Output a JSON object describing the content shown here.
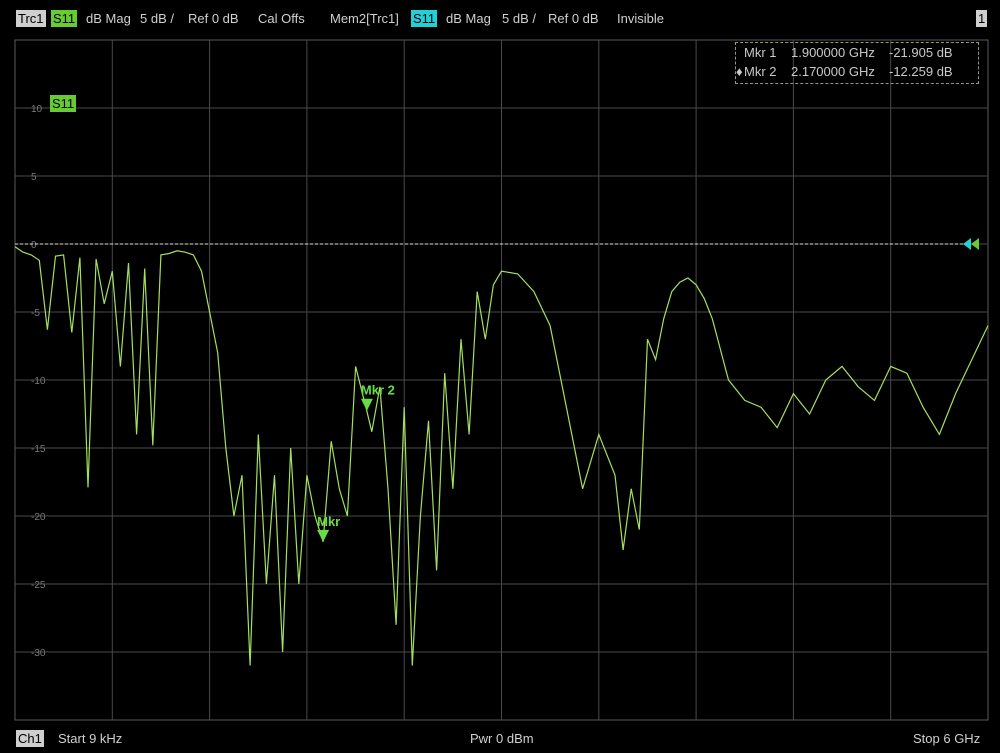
{
  "header": {
    "trace_label": "Trc1",
    "trace_param": "S11",
    "trace_format": "dB Mag",
    "trace_scale": "5 dB /",
    "trace_ref": "Ref 0 dB",
    "trace_cal": "Cal Offs",
    "mem_label": "Mem2[Trc1]",
    "mem_param": "S11",
    "mem_format": "dB Mag",
    "mem_scale": "5 dB /",
    "mem_ref": "Ref 0 dB",
    "mem_state": "Invisible",
    "window_number": "1"
  },
  "plot": {
    "trace_tag": "S11",
    "y_ticks": [
      "10",
      "5",
      "0",
      "-5",
      "-10",
      "-15",
      "-20",
      "-25",
      "-30"
    ],
    "colors": {
      "trace": "#a4e060",
      "marker": "#66dd44",
      "grid": "#4a4a4a",
      "reference_line": "#dddddd",
      "ref_arrow_cyan": "#22d0d8",
      "ref_arrow_green": "#66cc33"
    },
    "markers": [
      {
        "label": "Mkr",
        "freq_ghz": 1.9,
        "db": -21.905
      },
      {
        "label": "Mkr 2",
        "freq_ghz": 2.17,
        "db": -12.259
      }
    ]
  },
  "chart_data": {
    "type": "line",
    "title": "",
    "xlabel": "",
    "ylabel": "",
    "xlim": [
      9e-06,
      6
    ],
    "ylim": [
      -35,
      15
    ],
    "grid": true,
    "series": [
      {
        "name": "S11",
        "x": [
          0,
          0.05,
          0.1,
          0.15,
          0.2,
          0.25,
          0.3,
          0.35,
          0.4,
          0.45,
          0.5,
          0.55,
          0.6,
          0.65,
          0.7,
          0.75,
          0.8,
          0.85,
          0.9,
          0.95,
          1.0,
          1.05,
          1.1,
          1.15,
          1.2,
          1.25,
          1.3,
          1.35,
          1.4,
          1.45,
          1.5,
          1.55,
          1.6,
          1.65,
          1.7,
          1.75,
          1.8,
          1.85,
          1.9,
          1.95,
          2.0,
          2.05,
          2.1,
          2.17,
          2.2,
          2.25,
          2.3,
          2.35,
          2.4,
          2.45,
          2.5,
          2.55,
          2.6,
          2.65,
          2.7,
          2.75,
          2.8,
          2.85,
          2.9,
          2.95,
          3.0,
          3.1,
          3.2,
          3.3,
          3.4,
          3.5,
          3.6,
          3.7,
          3.75,
          3.8,
          3.85,
          3.9,
          3.95,
          4.0,
          4.05,
          4.1,
          4.15,
          4.2,
          4.25,
          4.3,
          4.4,
          4.5,
          4.6,
          4.7,
          4.8,
          4.9,
          5.0,
          5.1,
          5.2,
          5.3,
          5.4,
          5.5,
          5.6,
          5.7,
          5.8,
          5.9,
          6.0
        ],
        "values": [
          -0.2,
          -0.6,
          -0.8,
          -1.2,
          -6.3,
          -0.9,
          -0.8,
          -6.5,
          -1.0,
          -17.9,
          -1.1,
          -4.4,
          -2.0,
          -9.0,
          -1.4,
          -14.0,
          -1.8,
          -14.8,
          -0.8,
          -0.7,
          -0.5,
          -0.6,
          -0.8,
          -2.0,
          -5.0,
          -8.0,
          -15.0,
          -20.0,
          -17.0,
          -31.0,
          -14.0,
          -25.0,
          -17.0,
          -30.0,
          -15.0,
          -25.0,
          -17.0,
          -20.0,
          -21.9,
          -14.5,
          -18.0,
          -20.0,
          -9.0,
          -12.3,
          -13.8,
          -10.5,
          -18.0,
          -28.0,
          -12.0,
          -31.0,
          -20.0,
          -13.0,
          -24.0,
          -9.5,
          -18.0,
          -7.0,
          -14.0,
          -3.5,
          -7.0,
          -3.0,
          -2.0,
          -2.2,
          -3.5,
          -6.0,
          -12.0,
          -18.0,
          -14.0,
          -17.0,
          -22.5,
          -18.0,
          -21.0,
          -7.0,
          -8.5,
          -5.5,
          -3.5,
          -2.8,
          -2.5,
          -3.0,
          -4.0,
          -5.5,
          -10.0,
          -11.5,
          -12.0,
          -13.5,
          -11.0,
          -12.5,
          -10.0,
          -9.0,
          -10.5,
          -11.5,
          -9.0,
          -9.5,
          -12.0,
          -14.0,
          -11.0,
          -8.5,
          -6.0
        ]
      }
    ]
  },
  "footer": {
    "channel": "Ch1",
    "start": "Start  9 kHz",
    "power": "Pwr  0 dBm",
    "stop": "Stop  6 GHz"
  },
  "marker_table": {
    "rows": [
      {
        "bullet": "",
        "name": "Mkr 1",
        "freq": "1.900000 GHz",
        "value": "-21.905 dB"
      },
      {
        "bullet": "♦",
        "name": "Mkr 2",
        "freq": "2.170000 GHz",
        "value": "-12.259 dB"
      }
    ]
  }
}
